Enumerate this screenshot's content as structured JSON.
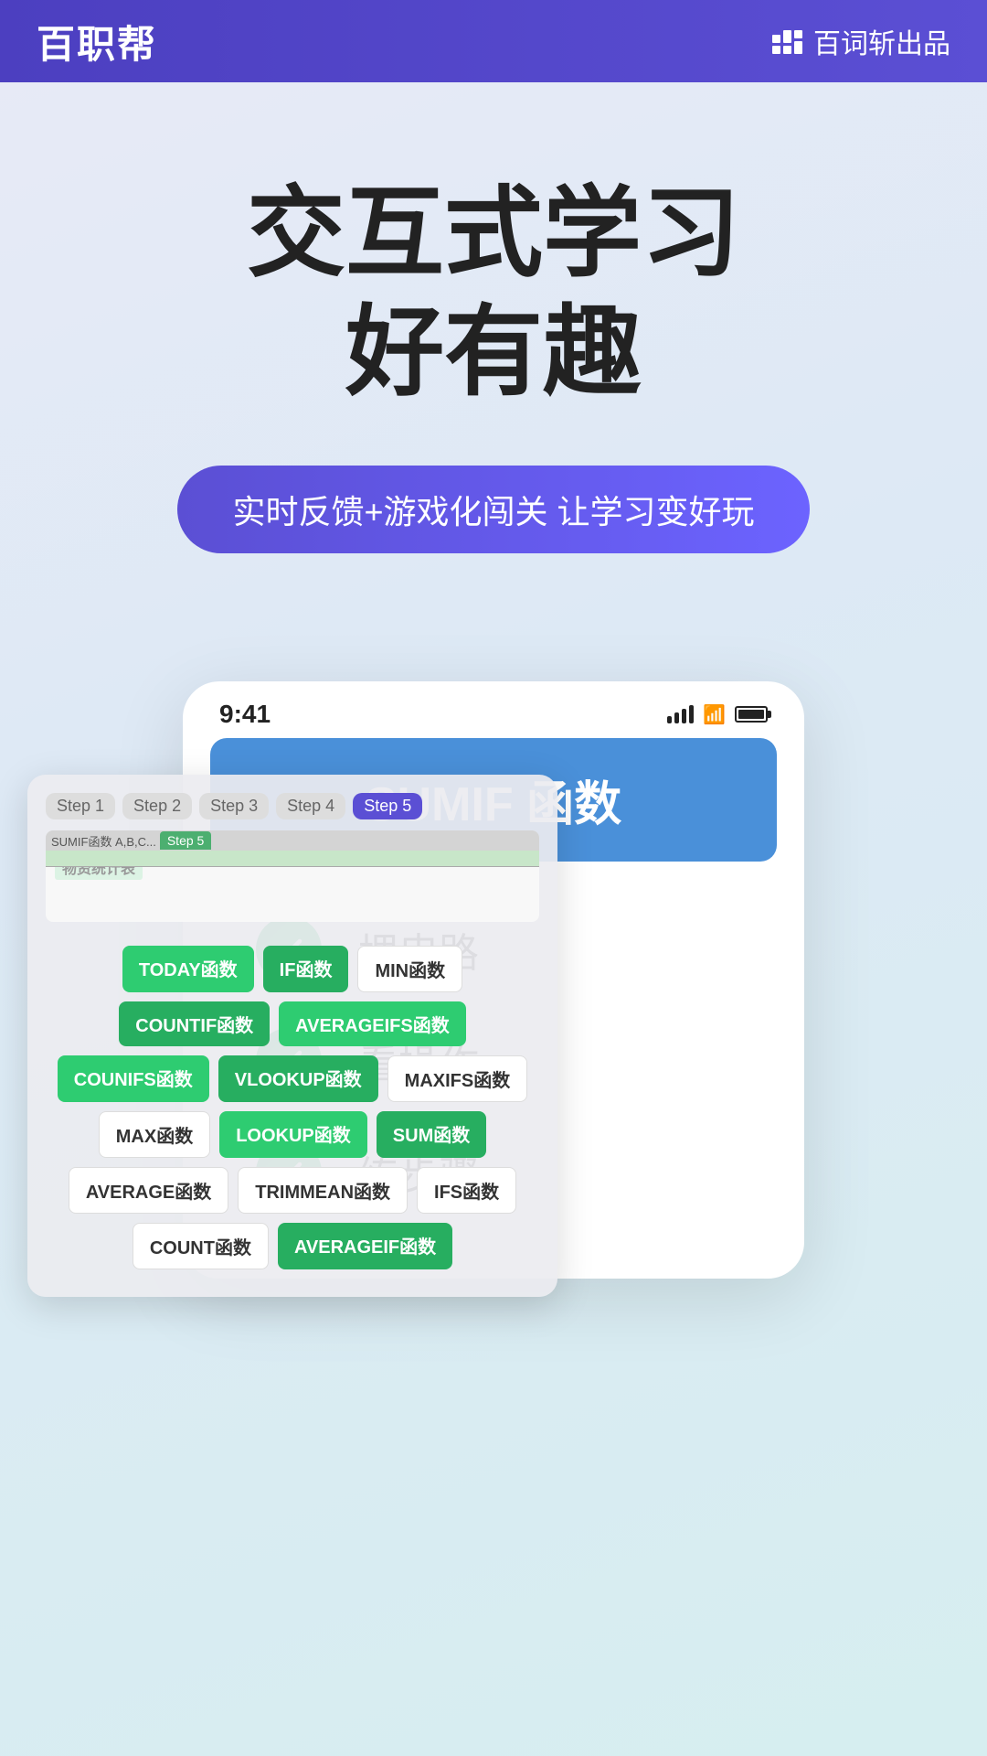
{
  "header": {
    "logo": "百职帮",
    "brand_icon_label": "百词斩出品"
  },
  "hero": {
    "title_line1": "交互式学习",
    "title_line2": "好有趣",
    "badge": "实时反馈+游戏化闯关  让学习变好玩"
  },
  "phone": {
    "time": "9:41",
    "header_text": "SUMIF 函数"
  },
  "steps": {
    "items": [
      "Step 1",
      "Step 2",
      "Step 3",
      "Step 4",
      "Step 5"
    ]
  },
  "tags": [
    {
      "label": "TODAY函数",
      "style": "green-light"
    },
    {
      "label": "IF函数",
      "style": "green-dark"
    },
    {
      "label": "MIN函数",
      "style": "white-tag"
    },
    {
      "label": "COUNTIF函数",
      "style": "green-dark"
    },
    {
      "label": "AVERAGEIFS函数",
      "style": "green-light"
    },
    {
      "label": "COUNIFS函数",
      "style": "green-light"
    },
    {
      "label": "VLOOKUP函数",
      "style": "green-dark"
    },
    {
      "label": "MAXIFS函数",
      "style": "white-tag"
    },
    {
      "label": "MAX函数",
      "style": "white-tag"
    },
    {
      "label": "LOOKUP函数",
      "style": "green-light"
    },
    {
      "label": "SUM函数",
      "style": "green-dark"
    },
    {
      "label": "AVERAGE函数",
      "style": "white-tag"
    },
    {
      "label": "TRIMMEAN函数",
      "style": "white-tag"
    },
    {
      "label": "IFS函数",
      "style": "white-tag"
    },
    {
      "label": "COUNT函数",
      "style": "white-tag"
    },
    {
      "label": "AVERAGEIF函数",
      "style": "green-dark"
    }
  ],
  "checklist": [
    {
      "label": "埋忠路"
    },
    {
      "label": "看操作"
    },
    {
      "label": "练步骤"
    }
  ],
  "excel": {
    "table_label": "物资统计表",
    "active_tab": "Step 5"
  }
}
